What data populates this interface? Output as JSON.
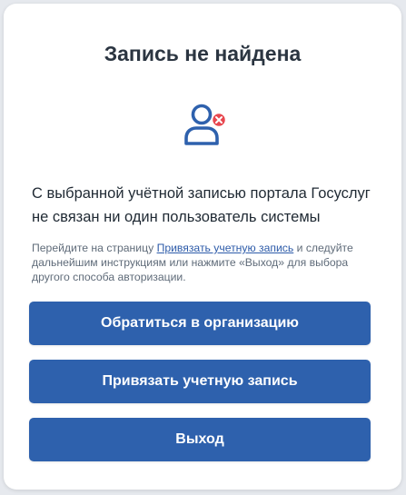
{
  "dialog": {
    "title": "Запись не найдена",
    "message": "С выбранной учётной записью портала Госуслуг не связан ни один пользователь системы",
    "hint_prefix": "Перейдите на страницу ",
    "hint_link": "Привязать учетную запись",
    "hint_suffix": " и следуйте дальнейшим инструкциям или нажмите «Выход» для выбора другого способа авторизации."
  },
  "buttons": {
    "contact_org": "Обратиться в организацию",
    "link_account": "Привязать учетную запись",
    "exit": "Выход"
  },
  "colors": {
    "accent": "#2e61ad",
    "error_badge": "#e8474f",
    "title_text": "#2b3541"
  },
  "icons": {
    "status": "user-not-found-icon"
  }
}
